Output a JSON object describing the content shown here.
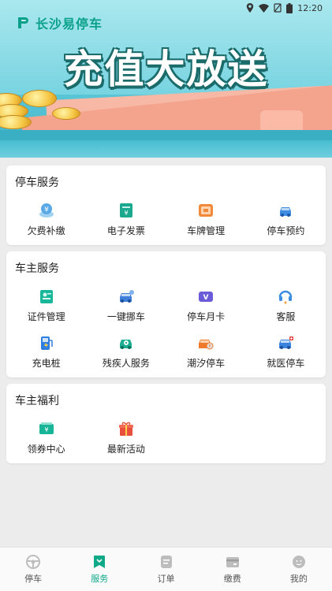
{
  "status_bar": {
    "time": "12:20"
  },
  "banner": {
    "app_name": "长沙易停车",
    "headline": "充值大放送"
  },
  "sections": [
    {
      "title": "停车服务",
      "items": [
        {
          "label": "欠费补缴",
          "icon": "yuan-wallet-icon"
        },
        {
          "label": "电子发票",
          "icon": "invoice-icon"
        },
        {
          "label": "车牌管理",
          "icon": "license-plate-icon"
        },
        {
          "label": "停车预约",
          "icon": "car-reserve-icon"
        }
      ]
    },
    {
      "title": "车主服务",
      "items": [
        {
          "label": "证件管理",
          "icon": "id-card-icon"
        },
        {
          "label": "一键挪车",
          "icon": "move-car-icon"
        },
        {
          "label": "停车月卡",
          "icon": "vip-card-icon"
        },
        {
          "label": "客服",
          "icon": "headset-icon"
        },
        {
          "label": "充电桩",
          "icon": "charging-pile-icon"
        },
        {
          "label": "残疾人服务",
          "icon": "wheelchair-icon"
        },
        {
          "label": "潮汐停车",
          "icon": "tide-parking-icon"
        },
        {
          "label": "就医停车",
          "icon": "medical-car-icon"
        }
      ]
    },
    {
      "title": "车主福利",
      "items": [
        {
          "label": "领券中心",
          "icon": "coupon-icon"
        },
        {
          "label": "最新活动",
          "icon": "gift-icon"
        }
      ]
    }
  ],
  "tabbar": [
    {
      "label": "停车",
      "icon": "steering-wheel-icon",
      "active": false
    },
    {
      "label": "服务",
      "icon": "service-icon",
      "active": true
    },
    {
      "label": "订单",
      "icon": "order-icon",
      "active": false
    },
    {
      "label": "缴费",
      "icon": "payment-icon",
      "active": false
    },
    {
      "label": "我的",
      "icon": "profile-icon",
      "active": false
    }
  ]
}
